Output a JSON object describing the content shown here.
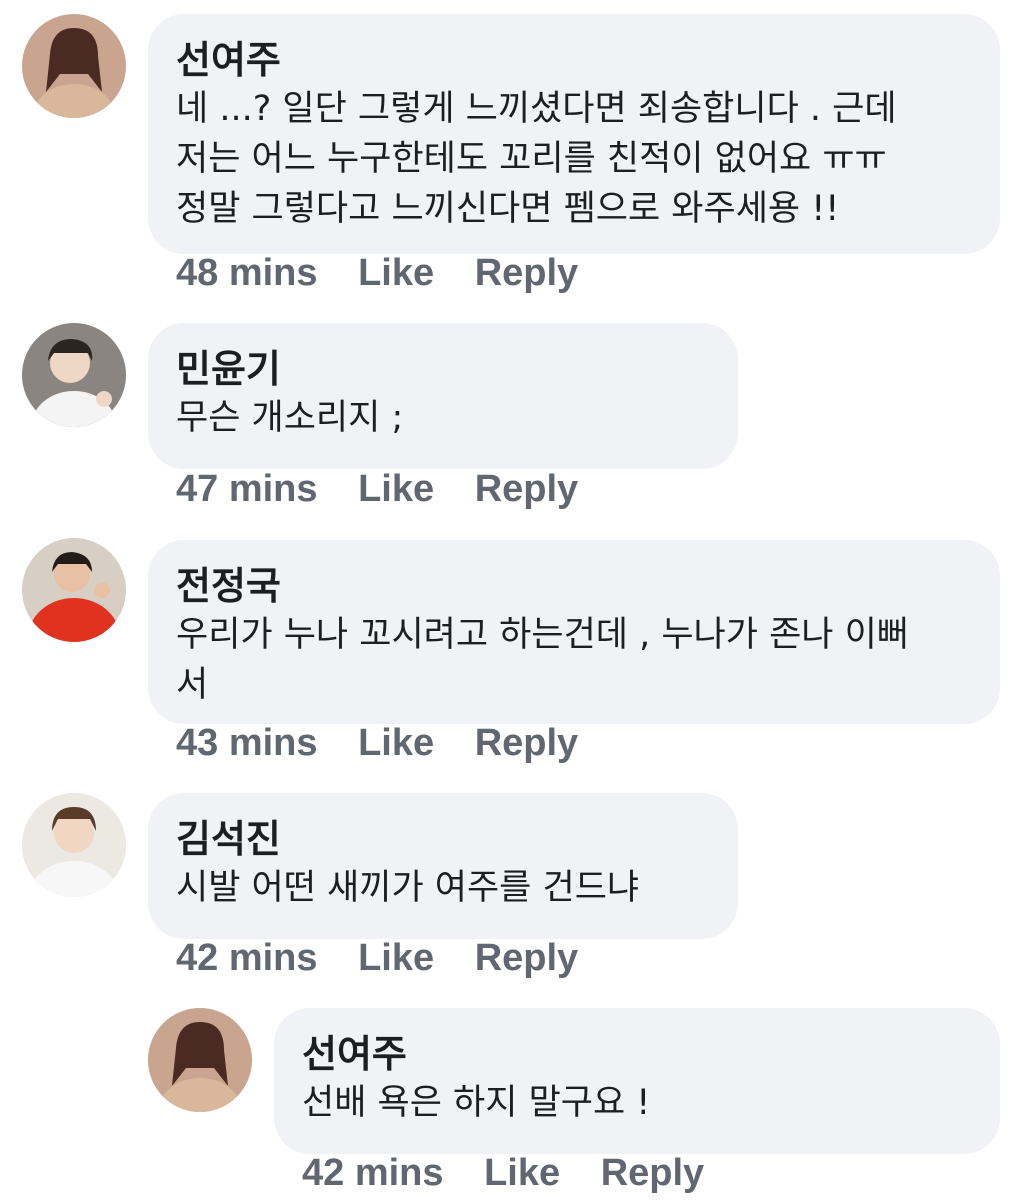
{
  "colors": {
    "bubble_bg": "#f0f2f5",
    "meta_text": "#606770",
    "author_text": "#1c1e21"
  },
  "comments": [
    {
      "author": "선여주",
      "text": "네 ...?  일단 그렇게 느끼셨다면 죄송합니다 . 근데\n저는 어느 누구한테도 꼬리를 친적이 없어요 ㅠㅠ\n정말 그렇다고 느끼신다면 펨으로 와주세용 !!",
      "time": "48 mins",
      "like": "Like",
      "reply": "Reply",
      "avatar_icon": "user-avatar-icon"
    },
    {
      "author": "민윤기",
      "text": "무슨 개소리지 ;",
      "time": "47 mins",
      "like": "Like",
      "reply": "Reply",
      "avatar_icon": "user-avatar-icon"
    },
    {
      "author": "전정국",
      "text": "우리가 누나 꼬시려고 하는건데 , 누나가 존나 이뻐\n서",
      "time": "43 mins",
      "like": "Like",
      "reply": "Reply",
      "avatar_icon": "user-avatar-icon"
    },
    {
      "author": "김석진",
      "text": "시발 어떤 새끼가 여주를 건드냐",
      "time": "42 mins",
      "like": "Like",
      "reply": "Reply",
      "avatar_icon": "user-avatar-icon"
    },
    {
      "author": "선여주",
      "text": "선배 욕은 하지 말구요 !",
      "time": "42 mins",
      "like": "Like",
      "reply": "Reply",
      "avatar_icon": "user-avatar-icon"
    }
  ]
}
